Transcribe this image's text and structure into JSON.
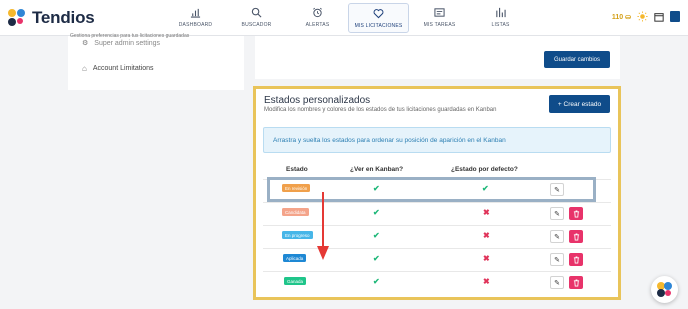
{
  "app": {
    "name": "Tendios"
  },
  "nav": [
    {
      "label": "DASHBOARD",
      "icon": "bar-chart-icon"
    },
    {
      "label": "BUSCADOR",
      "icon": "search-icon"
    },
    {
      "label": "ALERTAS",
      "icon": "alarm-clock-icon"
    },
    {
      "label": "MIS LICITACIONES",
      "icon": "heart-icon",
      "active": true
    },
    {
      "label": "MIS TAREAS",
      "icon": "task-board-icon"
    },
    {
      "label": "LISTAS",
      "icon": "list-chart-icon"
    }
  ],
  "topright": {
    "credits": "110"
  },
  "left_panel": {
    "subtitle": "Gestiona preferencias para tus licitaciones guardadas",
    "item_partial": "Super admin settings",
    "account_limitations": "Account Limitations"
  },
  "settings_card": {
    "save_label": "Guardar cambios"
  },
  "estados": {
    "title": "Estados personalizados",
    "subtitle": "Modifica los nombres y colores de los estados de tus licitaciones guardadas en Kanban",
    "create_label": "+ Crear estado",
    "info": "Arrastra y suelta los estados para ordenar su posición de aparición en el Kanban",
    "headers": {
      "estado": "Estado",
      "kanban": "¿Ver en Kanban?",
      "default": "¿Estado por defecto?"
    },
    "rows": [
      {
        "label": "En revisión",
        "color": "#f0a04b",
        "kanban": true,
        "default": true,
        "deletable": false
      },
      {
        "label": "Candidata",
        "color": "#f4a48a",
        "kanban": true,
        "default": false,
        "deletable": true
      },
      {
        "label": "En progreso",
        "color": "#47b6e8",
        "kanban": true,
        "default": false,
        "deletable": true
      },
      {
        "label": "Aplicada",
        "color": "#1e88d4",
        "kanban": true,
        "default": false,
        "deletable": true
      },
      {
        "label": "Ganada",
        "color": "#1fc58a",
        "kanban": true,
        "default": false,
        "deletable": true
      }
    ]
  },
  "colors": {
    "brand": "#0f4c8a",
    "highlight": "#e9c45a",
    "danger": "#e8336a",
    "success": "#21b87a"
  }
}
